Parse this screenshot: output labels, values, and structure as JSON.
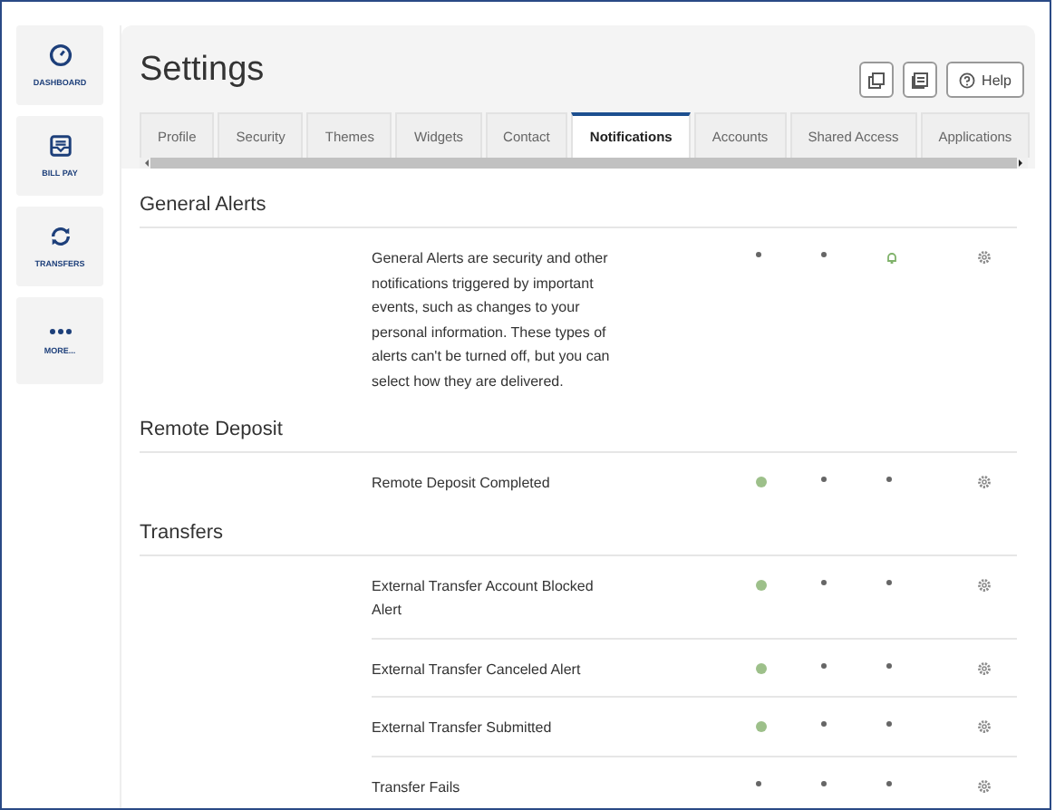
{
  "sidebar": {
    "items": [
      {
        "kind": "dashboard",
        "label": "DASHBOARD"
      },
      {
        "kind": "billpay",
        "label": "BILL PAY"
      },
      {
        "kind": "transfers",
        "label": "TRANSFERS"
      },
      {
        "kind": "more",
        "label": "MORE..."
      }
    ]
  },
  "header": {
    "title": "Settings",
    "help": "Help"
  },
  "tabs": [
    {
      "label": "Profile",
      "selected": false
    },
    {
      "label": "Security",
      "selected": false
    },
    {
      "label": "Themes",
      "selected": false
    },
    {
      "label": "Widgets",
      "selected": false
    },
    {
      "label": "Contact",
      "selected": false
    },
    {
      "label": "Notifications",
      "selected": true
    },
    {
      "label": "Accounts",
      "selected": false
    },
    {
      "label": "Shared Access",
      "selected": false
    },
    {
      "label": "Applications",
      "selected": false
    }
  ],
  "sections": [
    {
      "title": "General Alerts",
      "rows": [
        {
          "text": "General Alerts are security and other notifications triggered by important events, such as changes to your personal information. These types of alerts can't be turned off, but you can select how they are delivered.",
          "channels": [
            {
              "kind": "dot"
            },
            {
              "kind": "dot"
            },
            {
              "kind": "bell"
            }
          ]
        }
      ]
    },
    {
      "title": "Remote Deposit",
      "rows": [
        {
          "text": "Remote Deposit Completed",
          "channels": [
            {
              "kind": "on"
            },
            {
              "kind": "dot"
            },
            {
              "kind": "dot"
            }
          ]
        }
      ]
    },
    {
      "title": "Transfers",
      "rows": [
        {
          "text": "External Transfer Account Blocked Alert",
          "channels": [
            {
              "kind": "on"
            },
            {
              "kind": "dot"
            },
            {
              "kind": "dot"
            }
          ]
        },
        {
          "text": "External Transfer Canceled Alert",
          "channels": [
            {
              "kind": "on"
            },
            {
              "kind": "dot"
            },
            {
              "kind": "dot"
            }
          ]
        },
        {
          "text": "External Transfer Submitted",
          "channels": [
            {
              "kind": "on"
            },
            {
              "kind": "dot"
            },
            {
              "kind": "dot"
            }
          ]
        },
        {
          "text": "Transfer Fails",
          "channels": [
            {
              "kind": "dot"
            },
            {
              "kind": "dot"
            },
            {
              "kind": "dot"
            }
          ]
        }
      ]
    }
  ]
}
